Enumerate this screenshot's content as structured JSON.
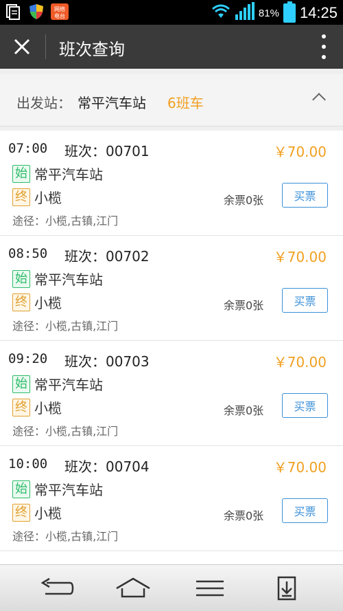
{
  "status_bar": {
    "battery_percent": "81%",
    "time": "14:25",
    "icons": [
      "notes-icon",
      "shield-icon",
      "network-app-icon",
      "wifi-icon",
      "signal-icon",
      "battery-icon"
    ],
    "network_app_label": "网络电台"
  },
  "action_bar": {
    "title": "班次查询"
  },
  "station": {
    "label": "出发站：",
    "name": "常平汽车站",
    "count": "6班车"
  },
  "trips": [
    {
      "time": "07:00",
      "shift": "班次：00701",
      "price": "￥70.00",
      "start_badge": "始",
      "start": "常平汽车站",
      "end_badge": "终",
      "end": "小榄",
      "route": "途径：小榄,古镇,江门",
      "remain": "余票0张",
      "buy": "买票"
    },
    {
      "time": "08:50",
      "shift": "班次：00702",
      "price": "￥70.00",
      "start_badge": "始",
      "start": "常平汽车站",
      "end_badge": "终",
      "end": "小榄",
      "route": "途径：小榄,古镇,江门",
      "remain": "余票0张",
      "buy": "买票"
    },
    {
      "time": "09:20",
      "shift": "班次：00703",
      "price": "￥70.00",
      "start_badge": "始",
      "start": "常平汽车站",
      "end_badge": "终",
      "end": "小榄",
      "route": "途径：小榄,古镇,江门",
      "remain": "余票0张",
      "buy": "买票"
    },
    {
      "time": "10:00",
      "shift": "班次：00704",
      "price": "￥70.00",
      "start_badge": "始",
      "start": "常平汽车站",
      "end_badge": "终",
      "end": "小榄",
      "route": "途径：小榄,古镇,江门",
      "remain": "余票0张",
      "buy": "买票"
    }
  ],
  "colors": {
    "price": "#f0a020",
    "accent": "#3a8fd8",
    "start_badge": "#2dbb6a",
    "end_badge": "#e0a030",
    "action_bar": "#3a3a3a"
  },
  "nav_bar": {
    "buttons": [
      "back-icon",
      "home-icon",
      "menu-icon",
      "download-icon"
    ]
  }
}
